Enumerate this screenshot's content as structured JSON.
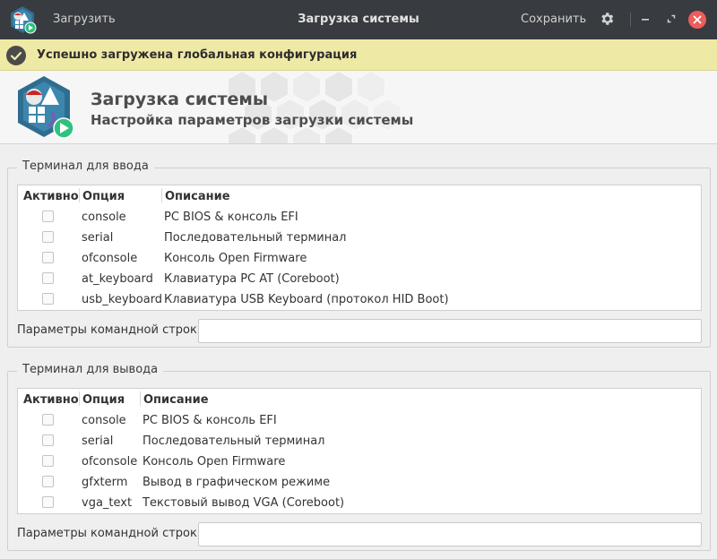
{
  "titlebar": {
    "open_label": "Загрузить",
    "title": "Загрузка системы",
    "save_label": "Сохранить",
    "icons": [
      "app-icon",
      "gear-icon",
      "minimize-icon",
      "maximize-icon",
      "close-icon"
    ]
  },
  "infobar": {
    "message": "Успешно загружена глобальная конфигурация",
    "icon": "check-icon"
  },
  "header": {
    "title": "Загрузка системы",
    "subtitle": "Настройка параметров загрузки системы"
  },
  "input_terminal": {
    "title": "Терминал для ввода",
    "columns": [
      "Активно",
      "Опция",
      "Описание"
    ],
    "rows": [
      {
        "option": "console",
        "description": "PC BIOS & консоль EFI"
      },
      {
        "option": "serial",
        "description": "Последовательный терминал"
      },
      {
        "option": "ofconsole",
        "description": "Консоль Open Firmware"
      },
      {
        "option": "at_keyboard",
        "description": "Клавиатура PC AT (Coreboot)"
      },
      {
        "option": "usb_keyboard",
        "description": "Клавиатура USB Keyboard (протокол HID Boot)"
      }
    ],
    "cmdline_label": "Параметры командной строки:",
    "cmdline_value": ""
  },
  "output_terminal": {
    "title": "Терминал для вывода",
    "columns": [
      "Активно",
      "Опция",
      "Описание"
    ],
    "rows": [
      {
        "option": "console",
        "description": "PC BIOS & консоль EFI"
      },
      {
        "option": "serial",
        "description": "Последовательный терминал"
      },
      {
        "option": "ofconsole",
        "description": "Консоль Open Firmware"
      },
      {
        "option": "gfxterm",
        "description": "Вывод в графическом режиме"
      },
      {
        "option": "vga_text",
        "description": "Текстовый вывод VGA (Coreboot)"
      }
    ],
    "cmdline_label": "Параметры командной строки:",
    "cmdline_value": ""
  },
  "colors": {
    "titlebar_bg": "#383b3f",
    "infobar_bg": "#efe9a6",
    "close_button": "#ec5d5d",
    "accent_green": "#2ec27e",
    "logo_blue": "#2f6d8f"
  }
}
